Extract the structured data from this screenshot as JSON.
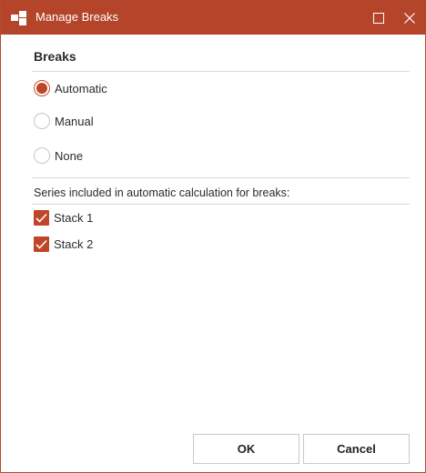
{
  "window": {
    "title": "Manage Breaks",
    "accent_color": "#b4452a",
    "icons": [
      "app-logo-icon",
      "maximize-icon",
      "close-icon"
    ]
  },
  "breaks": {
    "section_title": "Breaks",
    "options": [
      {
        "label": "Automatic",
        "checked": true
      },
      {
        "label": "Manual",
        "checked": false
      },
      {
        "label": "None",
        "checked": false
      }
    ]
  },
  "series": {
    "heading": "Series included in automatic calculation for breaks:",
    "items": [
      {
        "label": "Stack 1",
        "checked": true
      },
      {
        "label": "Stack 2",
        "checked": true
      }
    ]
  },
  "buttons": {
    "ok": "OK",
    "cancel": "Cancel"
  }
}
